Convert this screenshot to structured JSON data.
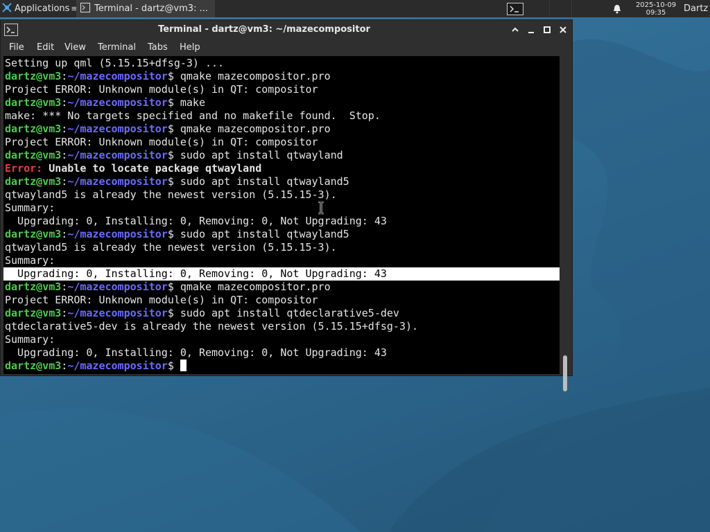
{
  "panel": {
    "applications_label": "Applications",
    "task_label": "Terminal - dartz@vm3: ...",
    "date": "2025-10-09",
    "time": "09:35",
    "user": "Dartz"
  },
  "window": {
    "title": "Terminal - dartz@vm3: ~/mazecompositor",
    "menu": [
      "File",
      "Edit",
      "View",
      "Terminal",
      "Tabs",
      "Help"
    ]
  },
  "terminal": {
    "user_host": "dartz@vm3",
    "path": "~/mazecompositor",
    "lines": [
      {
        "type": "out",
        "text": "Setting up qml (5.15.15+dfsg-3) ..."
      },
      {
        "type": "cmd",
        "text": " qmake mazecompositor.pro"
      },
      {
        "type": "out",
        "text": "Project ERROR: Unknown module(s) in QT: compositor"
      },
      {
        "type": "cmd",
        "text": " make"
      },
      {
        "type": "out",
        "text": "make: *** No targets specified and no makefile found.  Stop."
      },
      {
        "type": "cmd",
        "text": " qmake mazecompositor.pro"
      },
      {
        "type": "out",
        "text": "Project ERROR: Unknown module(s) in QT: compositor"
      },
      {
        "type": "cmd",
        "text": " sudo apt install qtwayland"
      },
      {
        "type": "error",
        "label": "Error:",
        "text": " Unable to locate package qtwayland"
      },
      {
        "type": "cmd",
        "text": " sudo apt install qtwayland5"
      },
      {
        "type": "out",
        "text": "qtwayland5 is already the newest version (5.15.15-3)."
      },
      {
        "type": "out",
        "text": "Summary:"
      },
      {
        "type": "out",
        "text": "  Upgrading: 0, Installing: 0, Removing: 0, Not Upgrading: 43"
      },
      {
        "type": "cmd",
        "text": " sudo apt install qtwayland5"
      },
      {
        "type": "out",
        "text": "qtwayland5 is already the newest version (5.15.15-3)."
      },
      {
        "type": "out",
        "text": "Summary:"
      },
      {
        "type": "hl",
        "text": "  Upgrading: 0, Installing: 0, Removing: 0, Not Upgrading: 43"
      },
      {
        "type": "cmd",
        "text": " qmake mazecompositor.pro"
      },
      {
        "type": "out",
        "text": "Project ERROR: Unknown module(s) in QT: compositor"
      },
      {
        "type": "cmd",
        "text": " sudo apt install qtdeclarative5-dev"
      },
      {
        "type": "out",
        "text": "qtdeclarative5-dev is already the newest version (5.15.15+dfsg-3)."
      },
      {
        "type": "out",
        "text": "Summary:"
      },
      {
        "type": "out",
        "text": "  Upgrading: 0, Installing: 0, Removing: 0, Not Upgrading: 43"
      },
      {
        "type": "prompt",
        "text": " "
      }
    ]
  },
  "colors": {
    "prompt_user": "#4ecb4e",
    "prompt_path": "#6b6bff",
    "error": "#ef3b3b",
    "terminal_bg": "#000000"
  }
}
